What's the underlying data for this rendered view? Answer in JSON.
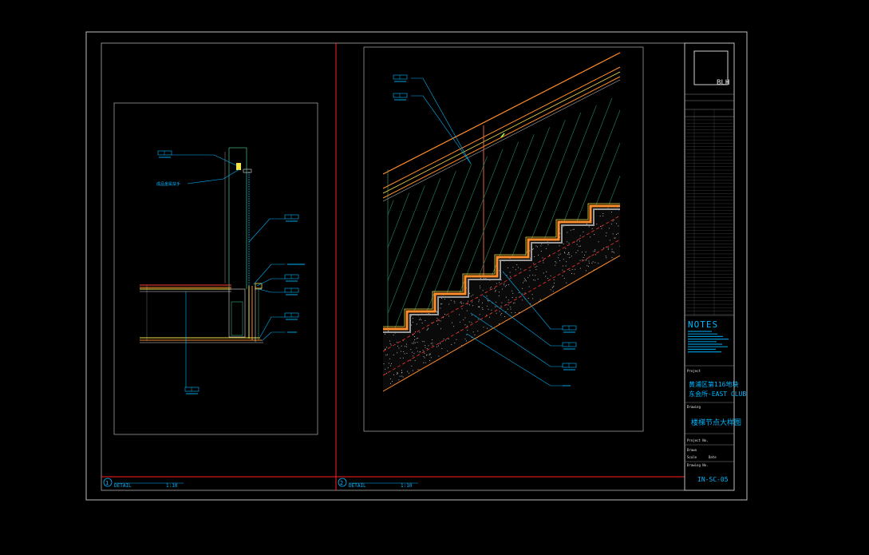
{
  "title_block": {
    "logo": "BLH",
    "notes_heading": "NOTES",
    "project_label": "Project",
    "project_name_line1": "黄浦区第116地块",
    "project_name_line2": "东会所-EAST CLUB",
    "drawing_label": "Drawing",
    "drawing_title": "楼梯节点大样图",
    "project_no_label": "Project No.",
    "drawn_label": "Drawn",
    "scale_label": "Scale",
    "date_label": "Date",
    "drawing_no_label": "Drawing No.",
    "drawing_no": "IN-SC-05"
  },
  "details": [
    {
      "number": "1",
      "label": "DETAIL",
      "scale": "1:10"
    },
    {
      "number": "2",
      "label": "DETAIL",
      "scale": "1:10"
    }
  ],
  "left_detail": {
    "callout_chinese": "成品金属扶手"
  },
  "colors": {
    "background": "#000000",
    "frame": "#c8c8c8",
    "sheet_divider": "#ff2020",
    "annotation": "#00b7ff",
    "stair_outline": "#ff8c2a",
    "finish": "#f5e34a",
    "hatch": "#1f8a5c"
  }
}
